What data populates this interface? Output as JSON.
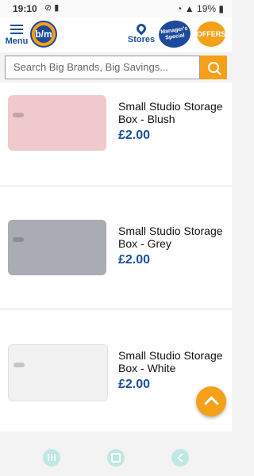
{
  "statusbar": {
    "time": "19:10",
    "battery": "19%"
  },
  "header": {
    "menu_label": "Menu",
    "logo_text": "b/m",
    "stores_label": "Stores",
    "managers_text": "Manager's Special",
    "offers_label": "OFFERS"
  },
  "search": {
    "placeholder": "Search Big Brands, Big Savings..."
  },
  "products": [
    {
      "name": "Small Studio Storage Box - Blush",
      "price": "£2.00",
      "color": "#f0c9cd"
    },
    {
      "name": "Small Studio Storage Box - Grey",
      "price": "£2.00",
      "color": "#a9adb3"
    },
    {
      "name": "Small Studio Storage Box - White",
      "price": "£2.00",
      "color": "#f2f2f2"
    }
  ],
  "colors": {
    "brand_blue": "#1b4f9c",
    "brand_orange": "#f5a019"
  }
}
